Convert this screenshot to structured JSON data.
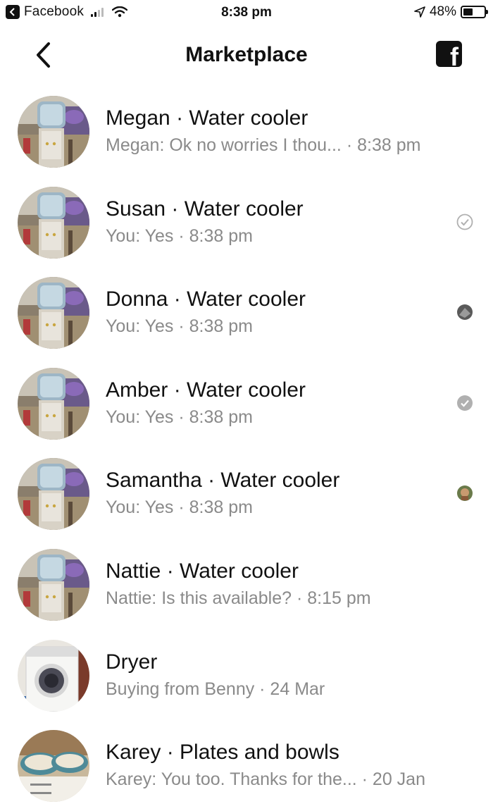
{
  "status_bar": {
    "app_name": "Facebook",
    "time": "8:38 pm",
    "battery": "48%",
    "battery_level": 0.48,
    "icons": [
      "back-app-icon",
      "signal-icon",
      "wifi-icon",
      "location-arrow-icon",
      "battery-icon"
    ]
  },
  "nav": {
    "title": "Marketplace",
    "back_icon": "chevron-left-icon",
    "right_icon": "facebook-logo-icon"
  },
  "conversations": [
    {
      "title": "Megan · Water cooler",
      "subtitle": "Megan: Ok no worries I thou...  · 8:38 pm",
      "avatar": "water-cooler",
      "indicator": "none"
    },
    {
      "title": "Susan · Water cooler",
      "subtitle": "You: Yes · 8:38 pm",
      "avatar": "water-cooler",
      "indicator": "sent-check"
    },
    {
      "title": "Donna · Water cooler",
      "subtitle": "You: Yes · 8:38 pm",
      "avatar": "water-cooler",
      "indicator": "seen-avatar-dark"
    },
    {
      "title": "Amber · Water cooler",
      "subtitle": "You: Yes · 8:38 pm",
      "avatar": "water-cooler",
      "indicator": "delivered-check"
    },
    {
      "title": "Samantha · Water cooler",
      "subtitle": "You: Yes · 8:38 pm",
      "avatar": "water-cooler",
      "indicator": "seen-avatar-face"
    },
    {
      "title": "Nattie · Water cooler",
      "subtitle": "Nattie: Is this available? · 8:15 pm",
      "avatar": "water-cooler",
      "indicator": "none"
    },
    {
      "title": "Dryer",
      "subtitle": "Buying from Benny · 24 Mar",
      "avatar": "dryer",
      "indicator": "none"
    },
    {
      "title": "Karey · Plates and bowls",
      "subtitle": "Karey: You too. Thanks for the...  · 20 Jan",
      "avatar": "plates",
      "indicator": "none"
    }
  ]
}
